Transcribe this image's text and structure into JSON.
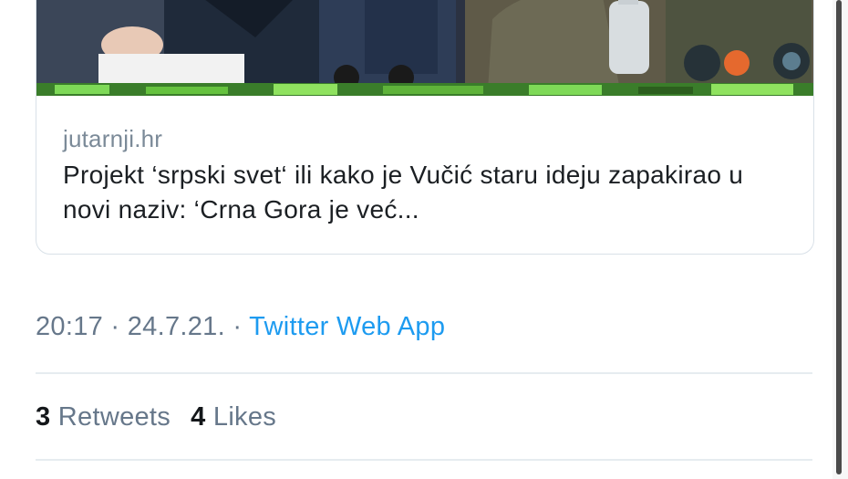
{
  "card": {
    "domain": "jutarnji.hr",
    "title": "Projekt ‘srpski svet‘ ili kako je Vučić staru ideju zapakirao u novi naziv: ‘Crna Gora je već..."
  },
  "meta": {
    "time": "20:17",
    "separator1": " · ",
    "date": "24.7.21.",
    "separator2": " · ",
    "source": "Twitter Web App"
  },
  "stats": {
    "retweets_count": "3",
    "retweets_label": "Retweets",
    "likes_count": "4",
    "likes_label": "Likes"
  },
  "colors": {
    "link_blue": "#1d9bf0",
    "muted_gray": "#66778a",
    "text_dark": "#14171a"
  }
}
